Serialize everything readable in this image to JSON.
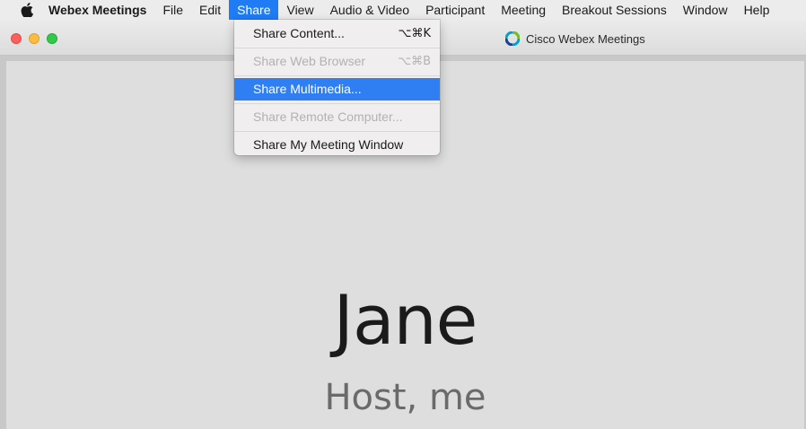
{
  "menubar": {
    "apple_icon": "apple-logo-icon",
    "items": [
      {
        "label": "Webex Meetings",
        "bold": true
      },
      {
        "label": "File"
      },
      {
        "label": "Edit"
      },
      {
        "label": "Share",
        "active": true
      },
      {
        "label": "View"
      },
      {
        "label": "Audio & Video"
      },
      {
        "label": "Participant"
      },
      {
        "label": "Meeting"
      },
      {
        "label": "Breakout Sessions"
      },
      {
        "label": "Window"
      },
      {
        "label": "Help"
      }
    ]
  },
  "window": {
    "title": "Cisco Webex Meetings",
    "title_icon": "webex-logo-icon"
  },
  "share_menu": {
    "items": [
      {
        "label": "Share Content...",
        "shortcut": "⌥⌘K",
        "enabled": true,
        "highlighted": false
      },
      {
        "label": "Share Web Browser",
        "shortcut": "⌥⌘B",
        "enabled": false,
        "highlighted": false
      },
      {
        "label": "Share Multimedia...",
        "shortcut": "",
        "enabled": true,
        "highlighted": true
      },
      {
        "label": "Share Remote Computer...",
        "shortcut": "",
        "enabled": false,
        "highlighted": false
      },
      {
        "label": "Share My Meeting Window",
        "shortcut": "",
        "enabled": true,
        "highlighted": false
      }
    ]
  },
  "participant": {
    "name": "Jane",
    "role": "Host, me"
  },
  "colors": {
    "menu_highlight": "#2f7ff2",
    "active_menu": "#1f7cf5",
    "content_bg": "#dedede"
  }
}
